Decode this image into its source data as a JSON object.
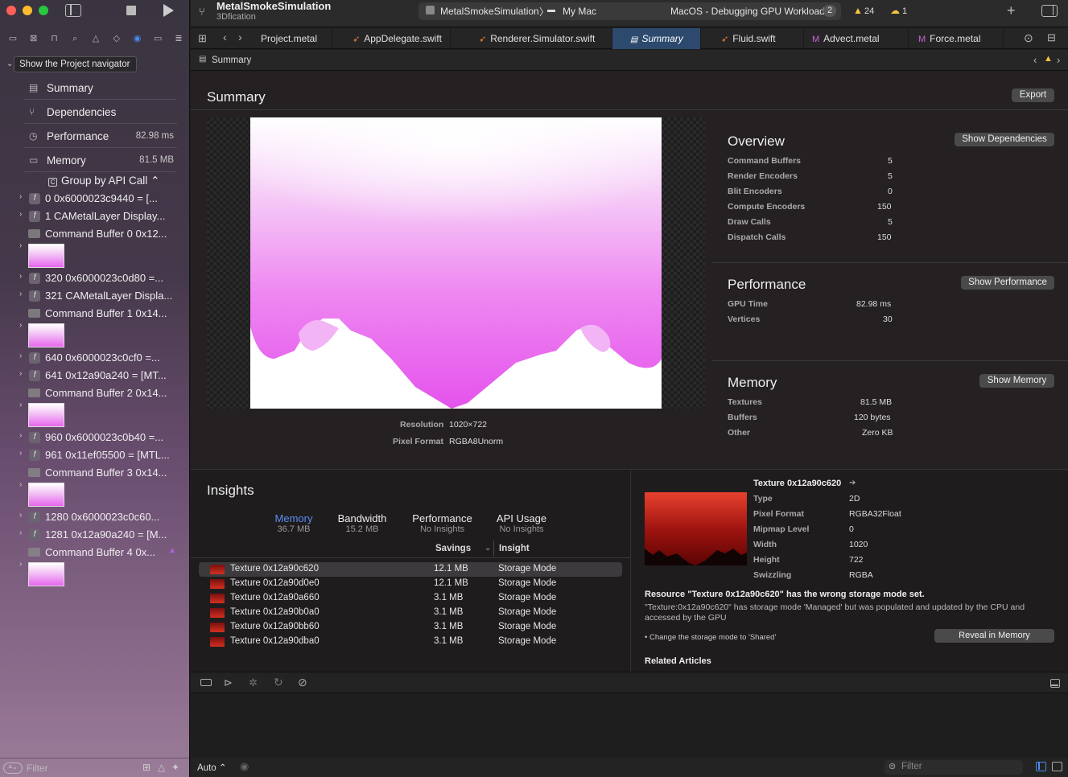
{
  "colors": {
    "accent": "#2d4a6e",
    "link_blue": "#5a8ef5",
    "warning": "#f5c542",
    "purple": "#b060e0"
  },
  "sidebar": {
    "tooltip": "Show the Project navigator",
    "sections": [
      {
        "label": "Summary",
        "value": ""
      },
      {
        "label": "Dependencies",
        "value": ""
      },
      {
        "label": "Performance",
        "value": "82.98 ms"
      },
      {
        "label": "Memory",
        "value": "81.5 MB"
      }
    ],
    "group_by": "Group by API Call",
    "tree": [
      "0 0x6000023c9440 = [...",
      "1 CAMetalLayer Display...",
      "Command Buffer 0 0x12...",
      "320 0x6000023c0d80 =...",
      "321 CAMetalLayer Displa...",
      "Command Buffer 1 0x14...",
      "640 0x6000023c0cf0 =...",
      "641 0x12a90a240 = [MT...",
      "Command Buffer 2 0x14...",
      "960 0x6000023c0b40 =...",
      "961 0x11ef05500 = [MTL...",
      "Command Buffer 3 0x14...",
      "1280 0x6000023c0c60...",
      "1281 0x12a90a240 = [M...",
      "Command Buffer 4 0x..."
    ],
    "filter_placeholder": "Filter"
  },
  "toolbar": {
    "project": "MetalSmokeSimulation",
    "subtitle": "3Dfication",
    "scheme": "MetalSmokeSimulation",
    "destination": "My Mac",
    "status": "MacOS - Debugging GPU Workload",
    "status_count": "2",
    "warnings": "24",
    "issues": "1"
  },
  "tabs": [
    "Project.metal",
    "AppDelegate.swift",
    "Renderer.Simulator.swift",
    "Summary",
    "Fluid.swift",
    "Advect.metal",
    "Force.metal"
  ],
  "jump_bar": "Summary",
  "summary": {
    "title": "Summary",
    "export": "Export",
    "resolution_label": "Resolution",
    "resolution": "1020×722",
    "pixel_format_label": "Pixel Format",
    "pixel_format": "RGBA8Unorm"
  },
  "overview": {
    "title": "Overview",
    "button": "Show Dependencies",
    "rows": [
      {
        "k": "Command Buffers",
        "v": "5"
      },
      {
        "k": "Render Encoders",
        "v": "5"
      },
      {
        "k": "Blit Encoders",
        "v": "0"
      },
      {
        "k": "Compute Encoders",
        "v": "150"
      },
      {
        "k": "Draw Calls",
        "v": "5"
      },
      {
        "k": "Dispatch Calls",
        "v": "150"
      }
    ]
  },
  "performance": {
    "title": "Performance",
    "button": "Show Performance",
    "rows": [
      {
        "k": "GPU Time",
        "v": "82.98 ms"
      },
      {
        "k": "Vertices",
        "v": "30"
      }
    ]
  },
  "memory": {
    "title": "Memory",
    "button": "Show Memory",
    "rows": [
      {
        "k": "Textures",
        "v": "81.5 MB"
      },
      {
        "k": "Buffers",
        "v": "120 bytes"
      },
      {
        "k": "Other",
        "v": "Zero KB"
      }
    ]
  },
  "insights": {
    "title": "Insights",
    "tabs": [
      {
        "name": "Memory",
        "sub": "36.7 MB"
      },
      {
        "name": "Bandwidth",
        "sub": "15.2 MB"
      },
      {
        "name": "Performance",
        "sub": "No Insights"
      },
      {
        "name": "API Usage",
        "sub": "No Insights"
      }
    ],
    "col_savings": "Savings",
    "col_insight": "Insight",
    "rows": [
      {
        "name": "Texture 0x12a90c620",
        "savings": "12.1 MB",
        "insight": "Storage Mode"
      },
      {
        "name": "Texture 0x12a90d0e0",
        "savings": "12.1 MB",
        "insight": "Storage Mode"
      },
      {
        "name": "Texture 0x12a90a660",
        "savings": "3.1 MB",
        "insight": "Storage Mode"
      },
      {
        "name": "Texture 0x12a90b0a0",
        "savings": "3.1 MB",
        "insight": "Storage Mode"
      },
      {
        "name": "Texture 0x12a90bb60",
        "savings": "3.1 MB",
        "insight": "Storage Mode"
      },
      {
        "name": "Texture 0x12a90dba0",
        "savings": "3.1 MB",
        "insight": "Storage Mode"
      }
    ]
  },
  "detail": {
    "title": "Texture 0x12a90c620",
    "rows": [
      {
        "k": "Type",
        "v": "2D"
      },
      {
        "k": "Pixel Format",
        "v": "RGBA32Float"
      },
      {
        "k": "Mipmap Level",
        "v": "0"
      },
      {
        "k": "Width",
        "v": "1020"
      },
      {
        "k": "Height",
        "v": "722"
      },
      {
        "k": "Swizzling",
        "v": "RGBA"
      }
    ],
    "heading": "Resource \"Texture 0x12a90c620\" has the wrong storage mode set.",
    "body": "\"Texture:0x12a90c620\" has storage mode 'Managed' but was populated and updated by the CPU and accessed by the GPU",
    "bullet": "• Change the storage mode to 'Shared'",
    "reveal": "Reveal in Memory",
    "related": "Related Articles"
  },
  "bottom": {
    "auto": "Auto",
    "filter_placeholder": "Filter"
  }
}
